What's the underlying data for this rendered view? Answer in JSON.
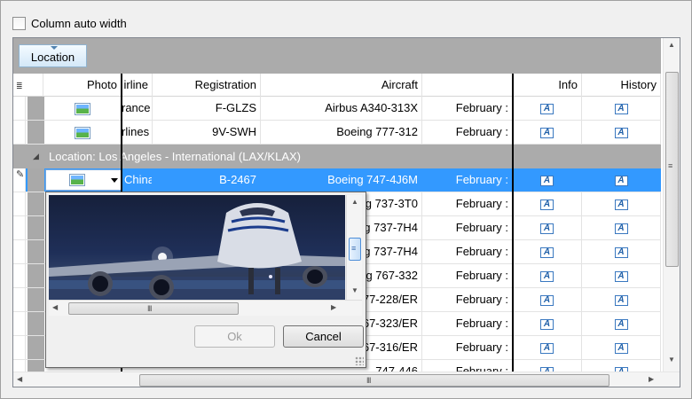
{
  "toolbar": {
    "auto_width_label": "Column auto width",
    "auto_width_checked": false
  },
  "grouping": {
    "group_button_label": "Location"
  },
  "columns": [
    "Photo",
    "irline",
    "Registration",
    "Aircraft",
    "",
    "Info",
    "History"
  ],
  "row_icons": {
    "photo": "image-icon",
    "info": "info-document-icon",
    "history": "info-document-icon",
    "editing": "pencil-icon"
  },
  "rows_top": [
    {
      "airline": "rance",
      "registration": "F-GLZS",
      "aircraft": "Airbus A340-313X",
      "date": "February :"
    },
    {
      "airline": "rlines",
      "registration": "9V-SWH",
      "aircraft": "Boeing 777-312",
      "date": "February :"
    }
  ],
  "group_row": {
    "label": "Location: Los Angeles - International (LAX/KLAX)"
  },
  "selected_row": {
    "airline": "China",
    "registration": "B-2467",
    "aircraft": "Boeing 747-4J6M",
    "date": "February :"
  },
  "rows_bottom": [
    {
      "aircraft": "g 737-3T0",
      "date": "February :"
    },
    {
      "aircraft": "g 737-7H4",
      "date": "February :"
    },
    {
      "aircraft": "g 737-7H4",
      "date": "February :"
    },
    {
      "aircraft": "g 767-332",
      "date": "February :"
    },
    {
      "aircraft": "77-228/ER",
      "date": "February :"
    },
    {
      "aircraft": "67-323/ER",
      "date": "February :"
    },
    {
      "aircraft": "67-316/ER",
      "date": "February :"
    },
    {
      "aircraft": "747-446",
      "date": "February :"
    }
  ],
  "popup": {
    "ok_label": "Ok",
    "cancel_label": "Cancel"
  },
  "scrollbar_glyph": "III"
}
